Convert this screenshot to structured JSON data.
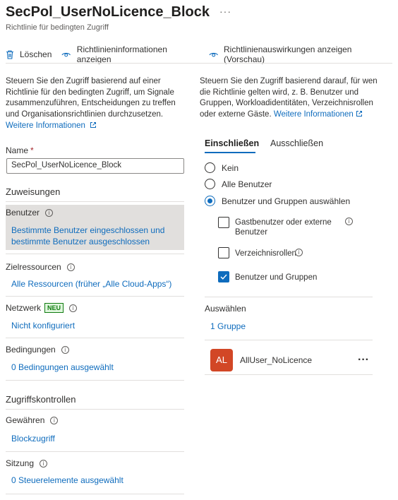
{
  "header": {
    "title": "SecPol_UserNoLicence_Block",
    "more": "···",
    "subtitle": "Richtlinie für bedingten Zugriff"
  },
  "toolbar": {
    "delete_label": "Löschen",
    "info_label": "Richtlinieninformationen anzeigen",
    "impact_label": "Richtlinienauswirkungen anzeigen (Vorschau)"
  },
  "left": {
    "description": "Steuern Sie den Zugriff basierend auf einer Richtlinie für den bedingten Zugriff, um Signale zusammenzuführen, Entscheidungen zu treffen und Organisationsrichtlinien durchzusetzen.",
    "more_info": "Weitere Informationen",
    "name_label": "Name",
    "name_required": "*",
    "name_value": "SecPol_UserNoLicence_Block",
    "assignments_heading": "Zuweisungen",
    "users_label": "Benutzer",
    "users_value": "Bestimmte Benutzer eingeschlossen und bestimmte Benutzer ausgeschlossen",
    "target_label": "Zielressourcen",
    "target_value": "Alle Ressourcen (früher „Alle Cloud-Apps“)",
    "network_label": "Netzwerk",
    "network_badge": "NEU",
    "network_value": "Nicht konfiguriert",
    "conditions_label": "Bedingungen",
    "conditions_value": "0 Bedingungen ausgewählt",
    "access_controls_heading": "Zugriffskontrollen",
    "grant_label": "Gewähren",
    "grant_value": "Blockzugriff",
    "session_label": "Sitzung",
    "session_value": "0 Steuerelemente ausgewählt"
  },
  "right": {
    "description": "Steuern Sie den Zugriff basierend darauf, für wen die Richtlinie gelten wird, z. B. Benutzer und Gruppen, Workloadidentitäten, Verzeichnisrollen oder externe Gäste.",
    "more_info": "Weitere Informationen",
    "tabs": [
      {
        "label": "Einschließen",
        "active": true
      },
      {
        "label": "Ausschließen",
        "active": false
      }
    ],
    "radios": [
      {
        "label": "Kein",
        "checked": false
      },
      {
        "label": "Alle Benutzer",
        "checked": false
      },
      {
        "label": "Benutzer und Gruppen auswählen",
        "checked": true
      }
    ],
    "checkboxes": [
      {
        "label": "Gastbenutzer oder externe Benutzer",
        "checked": false
      },
      {
        "label": "Verzeichnisrollen",
        "checked": false
      },
      {
        "label": "Benutzer und Gruppen",
        "checked": true
      }
    ],
    "select_label": "Auswählen",
    "select_value": "1 Gruppe",
    "group": {
      "initials": "AL",
      "name": "AllUser_NoLicence",
      "more": "···"
    }
  },
  "colors": {
    "accent": "#0f6cbd",
    "avatar": "#d24726",
    "badge": "#107c10"
  },
  "icons": [
    "trash-icon",
    "eye-icon",
    "eye-icon",
    "external-link-icon",
    "info-icon",
    "checkmark-icon"
  ]
}
